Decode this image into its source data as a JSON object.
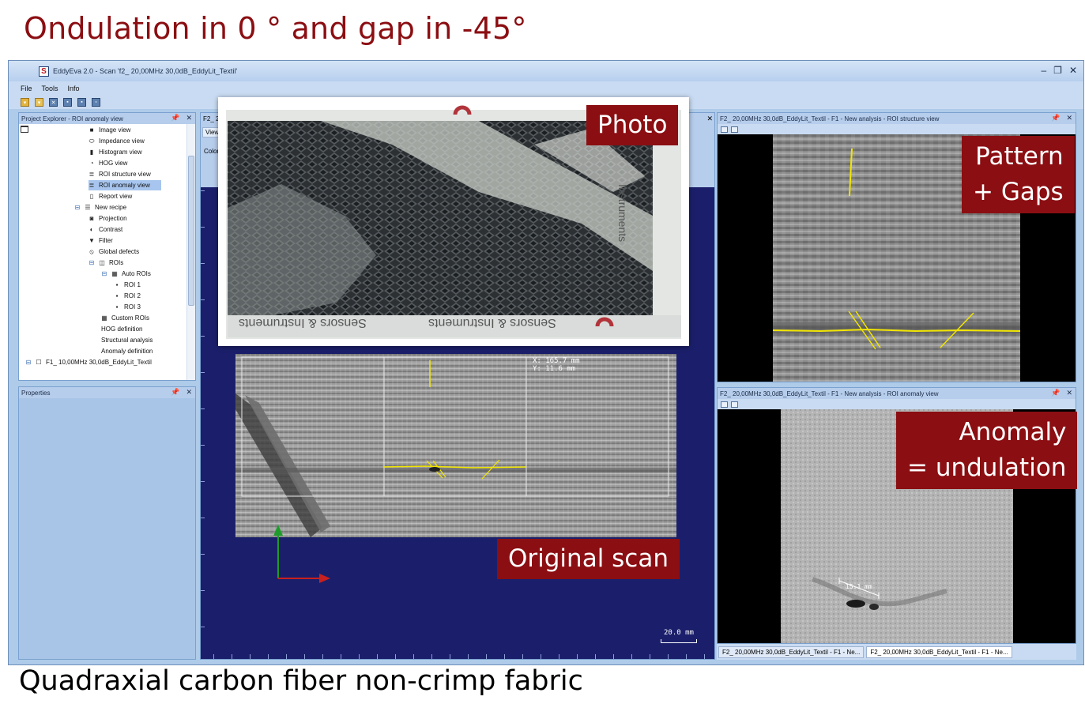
{
  "slide": {
    "title": "Ondulation in 0 ° and gap in -45°",
    "caption": "Quadraxial carbon fiber non-crimp fabric"
  },
  "app": {
    "title": "EddyEva 2.0 - Scan 'f2_ 20,00MHz 30,0dB_EddyLit_Textil'",
    "logo_letter": "S",
    "menu": [
      "File",
      "Tools",
      "Info"
    ]
  },
  "explorer": {
    "header": "Project Explorer - ROI anomaly view",
    "items": [
      {
        "label": "Image view",
        "icon": "image-icon"
      },
      {
        "label": "Impedance view",
        "icon": "ellipse-icon"
      },
      {
        "label": "Histogram view",
        "icon": "histogram-icon"
      },
      {
        "label": "HOG view",
        "icon": "hog-icon"
      },
      {
        "label": "ROI structure view",
        "icon": "list-icon"
      },
      {
        "label": "ROI anomaly view",
        "icon": "list-icon"
      },
      {
        "label": "Report view",
        "icon": "report-icon"
      },
      {
        "label": "New recipe",
        "icon": "recipe-icon"
      },
      {
        "label": "Projection",
        "icon": "camera-icon"
      },
      {
        "label": "Contrast",
        "icon": "contrast-icon"
      },
      {
        "label": "Filter",
        "icon": "filter-icon"
      },
      {
        "label": "Global defects",
        "icon": "prohibit-icon"
      },
      {
        "label": "ROIs",
        "icon": "rois-icon"
      },
      {
        "label": "Auto ROIs",
        "icon": "grid-icon"
      },
      {
        "label": "ROI 1",
        "icon": "square-icon"
      },
      {
        "label": "ROI 2",
        "icon": "square-icon"
      },
      {
        "label": "ROI 3",
        "icon": "square-icon"
      },
      {
        "label": "Custom ROIs",
        "icon": "grid-icon"
      },
      {
        "label": "HOG definition",
        "icon": ""
      },
      {
        "label": "Structural analysis",
        "icon": ""
      },
      {
        "label": "Anomaly definition",
        "icon": ""
      },
      {
        "label": "F1_ 10,00MHz 30,0dB_EddyLit_Textil",
        "icon": "checkbox-icon"
      }
    ],
    "selected_index": 5
  },
  "properties": {
    "header": "Properties"
  },
  "center": {
    "tab": "F2_ 20",
    "view_tab": "View",
    "color_label": "Color",
    "coord_text": "X: 165.7 mm\nY: 11.6 mm",
    "scale_text": "20.0 mm"
  },
  "structure_view": {
    "header": "F2_ 20,00MHz 30,0dB_EddyLit_Textil - F1 - New analysis - ROI structure view"
  },
  "anomaly_view": {
    "header": "F2_ 20,00MHz 30,0dB_EddyLit_Textil - F1 - New analysis - ROI anomaly view",
    "measure": "15.1 mm"
  },
  "bottom_tabs": [
    "F2_ 20,00MHz 30,0dB_EddyLit_Textil - F1 - Ne...",
    "F2_ 20,00MHz 30,0dB_EddyLit_Textil - F1 - Ne..."
  ],
  "labels": {
    "photo": "Photo",
    "pattern_line1": "Pattern",
    "pattern_line2": "+ Gaps",
    "anomaly_line1": "Anomaly",
    "anomaly_line2": "= undulation",
    "original": "Original scan"
  },
  "photo_print": {
    "brand": "Sensors & Instruments",
    "brand_vertical": "Instruments"
  },
  "colors": {
    "label_bg": "#8b0e12",
    "title": "#8b0e12",
    "view_bg": "#1b1f6b",
    "annotation": "#f2e600"
  }
}
